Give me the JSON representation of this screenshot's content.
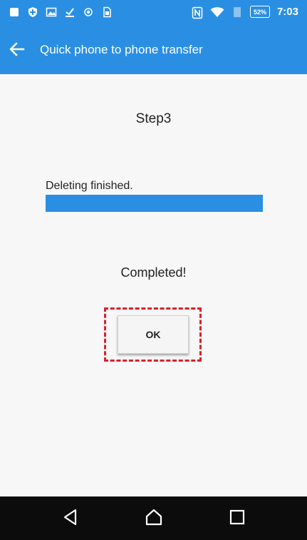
{
  "status_bar": {
    "battery": "52%",
    "time": "7:03",
    "icons_left": [
      "stop-icon",
      "shield-icon",
      "image-icon",
      "download-icon",
      "record-icon",
      "sim-icon"
    ],
    "icons_right": [
      "nfc-icon",
      "wifi-icon",
      "signal-icon",
      "battery-icon"
    ]
  },
  "app_bar": {
    "title": "Quick phone to phone transfer",
    "back_icon": "arrow-left-icon"
  },
  "content": {
    "step_title": "Step3",
    "progress_label": "Deleting finished.",
    "progress_value": 1.0,
    "completed_text": "Completed!",
    "ok_label": "OK"
  },
  "nav_bar": {
    "icons": [
      "nav-back-icon",
      "nav-home-icon",
      "nav-recents-icon"
    ]
  },
  "colors": {
    "accent": "#2a8fe3",
    "highlight": "#d9202c",
    "nav_background": "#0c0c0c"
  }
}
